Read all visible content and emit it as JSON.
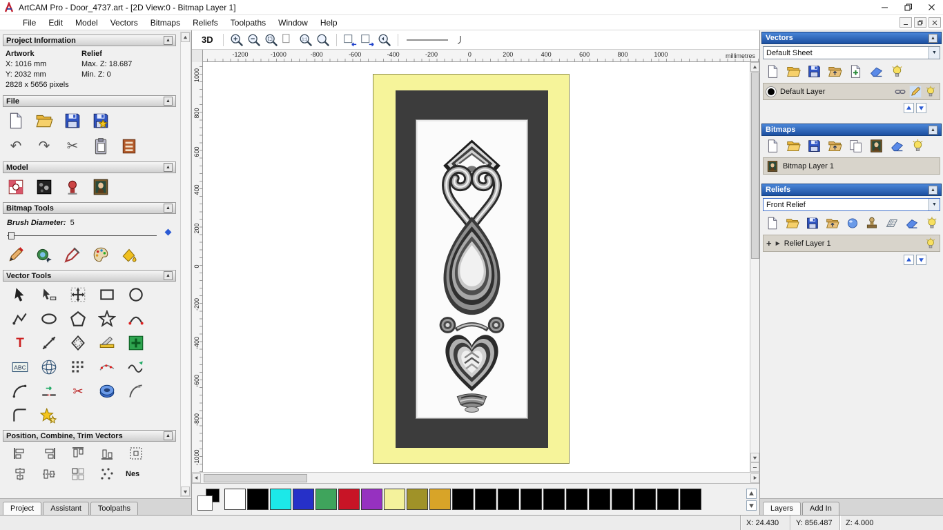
{
  "window": {
    "title": "ArtCAM Pro - Door_4737.art - [2D View:0 - Bitmap Layer 1]",
    "menus": [
      "File",
      "Edit",
      "Model",
      "Vectors",
      "Bitmaps",
      "Reliefs",
      "Toolpaths",
      "Window",
      "Help"
    ]
  },
  "left_panel": {
    "project_information": {
      "title": "Project Information",
      "artwork_label": "Artwork",
      "relief_label": "Relief",
      "x": "X: 1016 mm",
      "y": "Y: 2032 mm",
      "pixels": "2828 x 5656 pixels",
      "max_z": "Max. Z: 18.687",
      "min_z": "Min. Z: 0"
    },
    "file": {
      "title": "File",
      "icons_row1": [
        "new-file",
        "open-file",
        "save-file",
        "save-model"
      ],
      "icons_row2": [
        "undo",
        "redo",
        "cut",
        "paste",
        "notes"
      ]
    },
    "model": {
      "title": "Model",
      "icons": [
        "set-model-size",
        "adjust-model",
        "add-relief-clipart",
        "load-bitmap"
      ]
    },
    "bitmap_tools": {
      "title": "Bitmap Tools",
      "brush_diameter_label": "Brush Diameter:",
      "brush_diameter_value": "5",
      "icons": [
        "draw",
        "paint-selective",
        "colour-picker",
        "palette",
        "flood-fill"
      ]
    },
    "vector_tools": {
      "title": "Vector Tools",
      "row1": [
        "select-vectors",
        "node-editing",
        "transform-vectors",
        "create-rectangle",
        "create-circle"
      ],
      "row2": [
        "create-polyline",
        "create-ellipse",
        "create-polygon",
        "create-star",
        "create-arc"
      ],
      "row3": [
        "create-text",
        "measure",
        "offset-vector",
        "slice-vector",
        "paste-vector"
      ],
      "row4": [
        "text-block",
        "wrap-vectors",
        "block-copy",
        "fit-curve",
        "smooth-vectors"
      ],
      "row5": [
        "create-arc-3pt",
        "join-vectors",
        "trim-vectors",
        "extrude-vector",
        "fit-arcs"
      ],
      "row6": [
        "fillet-vectors",
        "spin-vectors"
      ]
    },
    "position_tools": {
      "title": "Position, Combine, Trim Vectors",
      "row1": [
        "align-left",
        "align-right",
        "align-top",
        "align-bottom",
        "align-center"
      ],
      "row2": [
        "align-h-center",
        "align-v-center",
        "block-paste",
        "scatter-copies"
      ],
      "nesting_label": "Nes"
    },
    "tabs": [
      {
        "label": "Project",
        "active": true
      },
      {
        "label": "Assistant",
        "active": false
      },
      {
        "label": "Toolpaths",
        "active": false
      }
    ]
  },
  "canvas": {
    "toolbar": {
      "view_3d": "3D",
      "zoom_icons": [
        "zoom-in",
        "zoom-out",
        "zoom-box",
        "zoom-page",
        "zoom-ratio",
        "zoom-plain"
      ],
      "nav_icons": [
        "view-previous",
        "view-next",
        "zoom-back"
      ]
    },
    "ruler": {
      "h": [
        "-1200",
        "-1000",
        "-800",
        "-600",
        "-400",
        "-200",
        "0",
        "200",
        "400",
        "600",
        "800",
        "1000"
      ],
      "v": [
        "1000",
        "800",
        "600",
        "400",
        "200",
        "0",
        "-200",
        "-400",
        "-600",
        "-800",
        "-1000"
      ],
      "unit": "millimetres"
    },
    "colors": {
      "primary": "#ffffff",
      "secondary": "#000000",
      "palette": [
        "#ffffff",
        "#000000",
        "#1ce8e8",
        "#2630c8",
        "#3fa45c",
        "#c81426",
        "#9631c0",
        "#f4f29c",
        "#a09228",
        "#d8a428",
        "#000000",
        "#000000",
        "#000000",
        "#000000",
        "#000000",
        "#000000",
        "#000000",
        "#000000",
        "#000000",
        "#000000",
        "#000000"
      ]
    }
  },
  "right_panel": {
    "vectors": {
      "title": "Vectors",
      "sheet_value": "Default Sheet",
      "icons": [
        "new-file",
        "open-file",
        "save-file",
        "merge-folder",
        "new-layer",
        "eraser",
        "bulb"
      ],
      "layer_name": "Default Layer",
      "layer_color": "#000000",
      "layer_icons": [
        "link",
        "edit",
        "bulb"
      ]
    },
    "bitmaps": {
      "title": "Bitmaps",
      "icons": [
        "new-file",
        "open-file",
        "save-file",
        "merge-folder",
        "copy",
        "load-bitmap",
        "eraser",
        "bulb"
      ],
      "layer_name": "Bitmap Layer 1"
    },
    "reliefs": {
      "title": "Reliefs",
      "relief_value": "Front Relief",
      "icons": [
        "new-file",
        "open-file",
        "save-file",
        "merge-folder",
        "sphere",
        "stamp",
        "grid3d",
        "eraser",
        "bulb"
      ],
      "layer_name": "Relief Layer 1",
      "layer_icons": [
        "bulb"
      ]
    },
    "tabs": [
      {
        "label": "Layers",
        "active": true
      },
      {
        "label": "Add In",
        "active": false
      }
    ]
  },
  "status_bar": {
    "x": "X: 24.430",
    "y": "Y: 856.487",
    "z": "Z: 4.000"
  }
}
